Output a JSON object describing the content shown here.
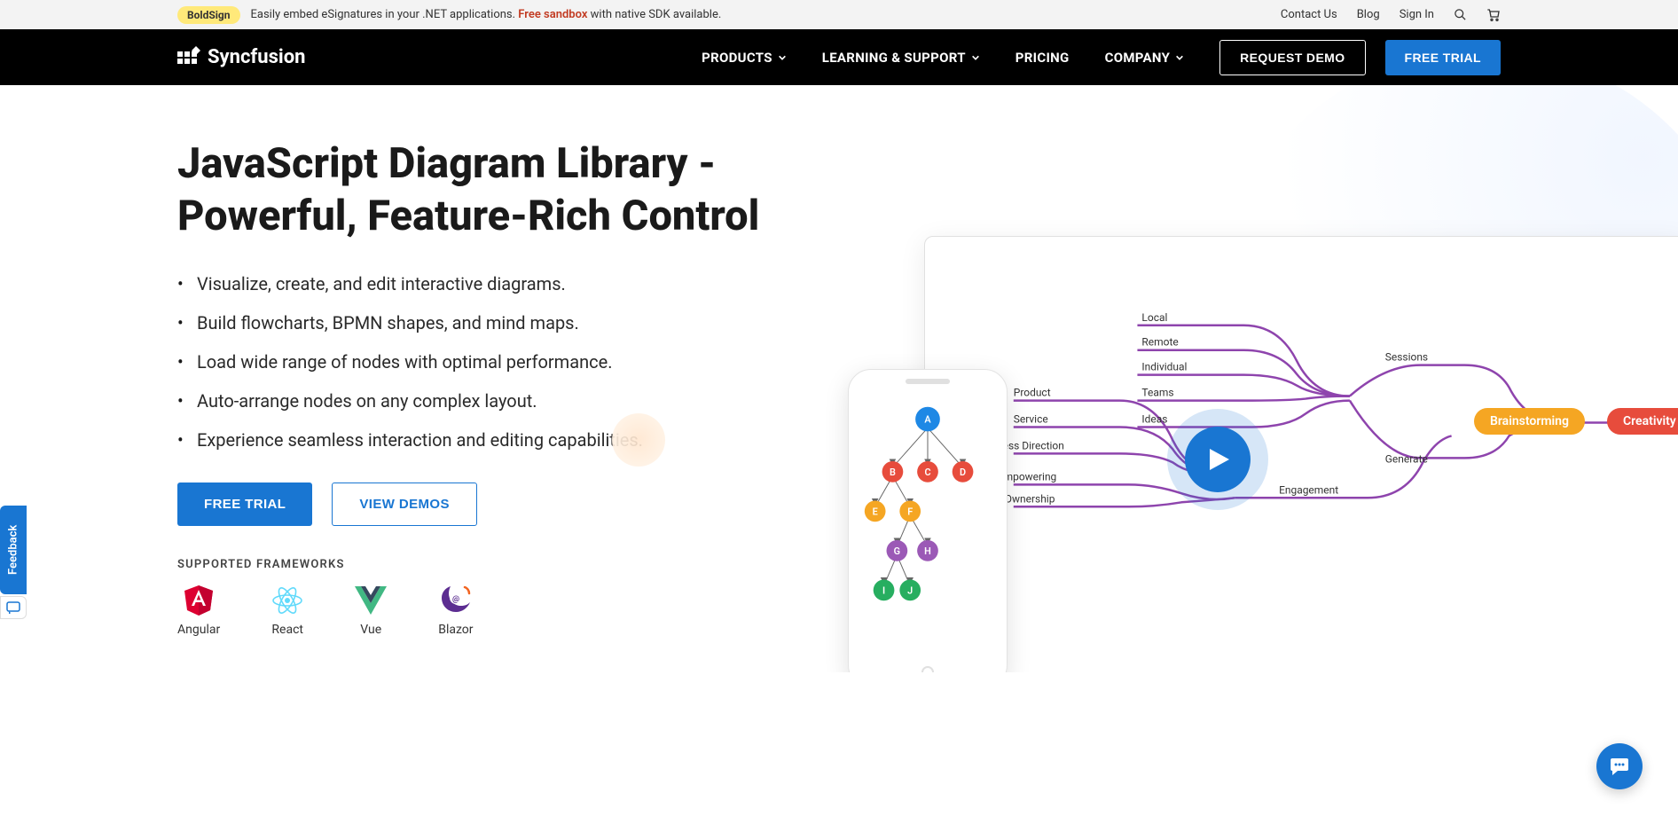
{
  "topbar": {
    "badge": "BoldSign",
    "text_pre": "Easily embed eSignatures in your .NET applications. ",
    "sandbox": "Free sandbox",
    "text_post": " with native SDK available.",
    "links": {
      "contact": "Contact Us",
      "blog": "Blog",
      "signin": "Sign In"
    }
  },
  "brand": "Syncfusion",
  "nav": {
    "products": "PRODUCTS",
    "learning": "LEARNING & SUPPORT",
    "pricing": "PRICING",
    "company": "COMPANY",
    "request_demo": "REQUEST DEMO",
    "free_trial": "FREE TRIAL"
  },
  "hero": {
    "title": "JavaScript Diagram Library - Powerful, Feature-Rich Control",
    "bullets": [
      "Visualize, create, and edit interactive diagrams.",
      "Build flowcharts, BPMN shapes, and mind maps.",
      "Load wide range of nodes with optimal performance.",
      "Auto-arrange nodes on any complex layout.",
      "Experience seamless interaction and editing capabilities."
    ],
    "cta_trial": "FREE TRIAL",
    "cta_demos": "VIEW DEMOS",
    "supported_label": "SUPPORTED FRAMEWORKS",
    "frameworks": [
      "Angular",
      "React",
      "Vue",
      "Blazor"
    ]
  },
  "mindmap": {
    "pill_brainstorming": "Brainstorming",
    "pill_creativity": "Creativity",
    "branch_left": [
      "Product",
      "Service",
      "Business Direction",
      "Empowering",
      "Ownership"
    ],
    "branch_mid": [
      "Local",
      "Remote",
      "Individual",
      "Teams",
      "Ideas"
    ],
    "branch_right": [
      "Sessions",
      "Generate",
      "Engagement"
    ]
  },
  "tree_letters": [
    "A",
    "B",
    "C",
    "D",
    "E",
    "F",
    "G",
    "H",
    "I",
    "J"
  ],
  "feedback": "Feedback"
}
